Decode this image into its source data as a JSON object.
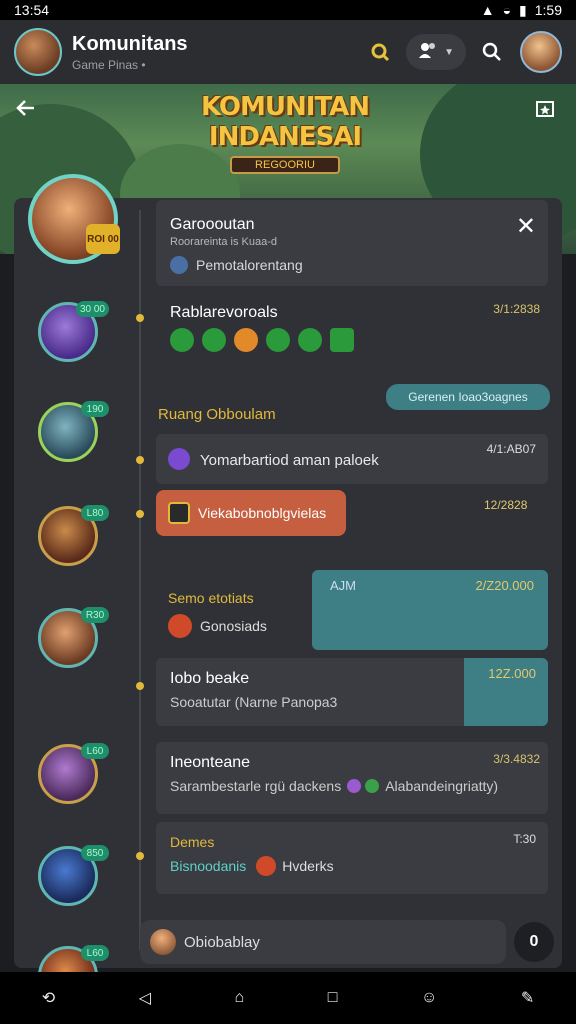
{
  "status_bar": {
    "time_left": "13:54",
    "time_right": "1:59"
  },
  "app_bar": {
    "title": "Komunitans",
    "subtitle": "Game Pinas •"
  },
  "banner": {
    "title_line1": "KOMUNITAN",
    "title_line2": "INDANESAI",
    "tag": "REGOORIU"
  },
  "pinned": {
    "title": "Garoooutan",
    "subtitle": "Roorareinta is Kuaa-d",
    "item": "Pemotalorentang"
  },
  "feed": [
    {
      "title": "Rablarevoroals",
      "time": "3/1:2838"
    },
    {
      "pill": "Gerenen Ioao3oagnes",
      "label": "Ruang Obboulam"
    },
    {
      "text": "Yomarbartiod aman paloek",
      "time": "4/1:AB07"
    },
    {
      "highlight": "Viekabobnoblgvielas",
      "time": "12/2828"
    },
    {
      "title": "Semo etotiats",
      "item": "Gonosiads",
      "teal_label": "AJM",
      "teal_value": "2/Z20.000"
    },
    {
      "title": "Iobo beake",
      "subtitle": "Sooatutar (Narne Panopa3",
      "teal_value": "12Z.000"
    },
    {
      "title": "Ineonteane",
      "subtitle_a": "Sarambestarle rgü dackens",
      "subtitle_b": "Alabandeingriatty)",
      "time": "3/3.4832"
    },
    {
      "title": "Demes",
      "item_a": "Bisnoodanis",
      "item_b": "Hvderks",
      "time": "T:30"
    }
  ],
  "member_badges": [
    "30 00",
    "190",
    "L80",
    "R30",
    "L60",
    "850",
    "L60"
  ],
  "big_badge": "ROI 00",
  "input": {
    "text": "Obiobablay",
    "send": "0"
  },
  "colors": {
    "accent": "#e1b93b",
    "teal": "#3e7f86",
    "highlight": "#c55f40"
  }
}
